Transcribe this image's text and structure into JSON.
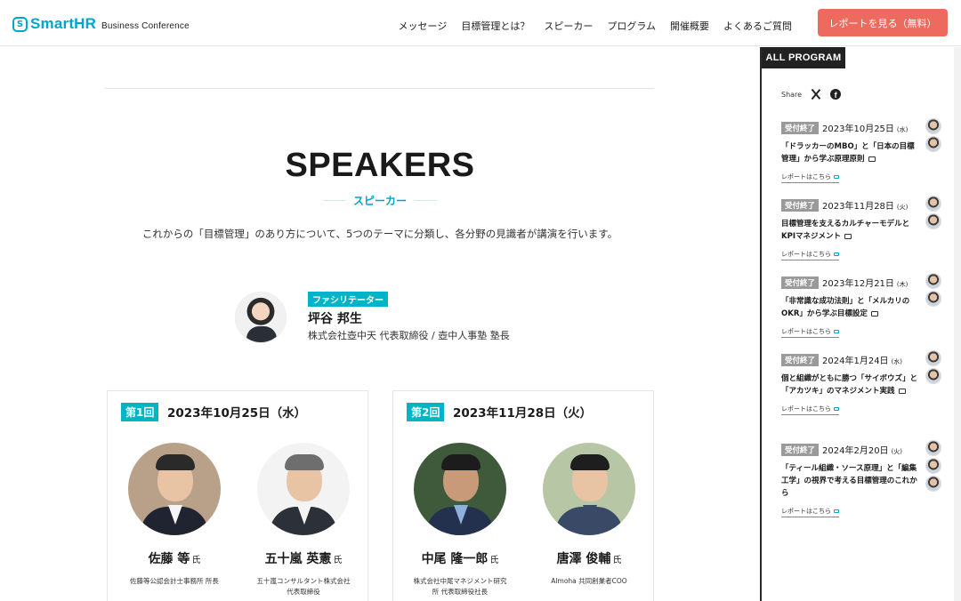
{
  "header": {
    "logo_mark": "S",
    "logo_text": "SmartHR",
    "logo_sub": "Business Conference",
    "nav": [
      "メッセージ",
      "目標管理とは？",
      "スピーカー",
      "プログラム",
      "開催概要",
      "よくあるご質問"
    ],
    "cta_label": "レポートを見る（無料）"
  },
  "main": {
    "title": "SPEAKERS",
    "subtitle": "スピーカー",
    "lead": "これからの「目標管理」のあり方について、5つのテーマに分類し、各分野の見識者が講演を行います。",
    "facilitator": {
      "badge": "ファシリテーター",
      "name": "坪谷 邦生",
      "role": "株式会社壺中天 代表取締役 / 壺中人事塾 塾長"
    },
    "cards": [
      {
        "round": "第1回",
        "date": "2023年10月25日（水）",
        "speakers": [
          {
            "name": "佐藤 等",
            "honorific": "氏",
            "org": "佐藤等公認会計士事務所 所長"
          },
          {
            "name": "五十嵐 英憲",
            "honorific": "氏",
            "org": "五十嵐コンサルタント株式会社\n代表取締役"
          }
        ]
      },
      {
        "round": "第2回",
        "date": "2023年11月28日（火）",
        "speakers": [
          {
            "name": "中尾 隆一郎",
            "honorific": "氏",
            "org": "株式会社中尾マネジメント研究\n所 代表取締役社長"
          },
          {
            "name": "唐澤 俊輔",
            "honorific": "氏",
            "org": "Almoha 共同創業者COO"
          }
        ]
      }
    ]
  },
  "sidebar": {
    "tab": "ALL PROGRAM",
    "share_label": "Share",
    "programs": [
      {
        "status": "受付終了",
        "date": "2023年10月25日",
        "dow": "(水)",
        "title": "「ドラッカーのMBO」と「日本の目標管理」から学ぶ原理原則",
        "link": "レポートはこちら"
      },
      {
        "status": "受付終了",
        "date": "2023年11月28日",
        "dow": "(火)",
        "title": "目標管理を支えるカルチャーモデルとKPIマネジメント",
        "link": "レポートはこちら"
      },
      {
        "status": "受付終了",
        "date": "2023年12月21日",
        "dow": "(木)",
        "title": "「非常識な成功法則」と「メルカリのOKR」から学ぶ目標設定",
        "link": "レポートはこちら"
      },
      {
        "status": "受付終了",
        "date": "2024年1月24日",
        "dow": "(水)",
        "title": "個と組織がともに勝つ「サイボウズ」と「アカツキ」のマネジメント実践",
        "link": "レポートはこちら"
      },
      {
        "status": "受付終了",
        "date": "2024年2月20日",
        "dow": "(火)",
        "title": "「ティール組織・ソース原理」と「編集工学」の視界で考える目標管理のこれから",
        "link": "レポートはこちら"
      }
    ]
  },
  "colors": {
    "brand": "#00a6c8",
    "cta": "#ed6a5e",
    "badge": "#00b4c8",
    "closed": "#9a9a9a"
  }
}
